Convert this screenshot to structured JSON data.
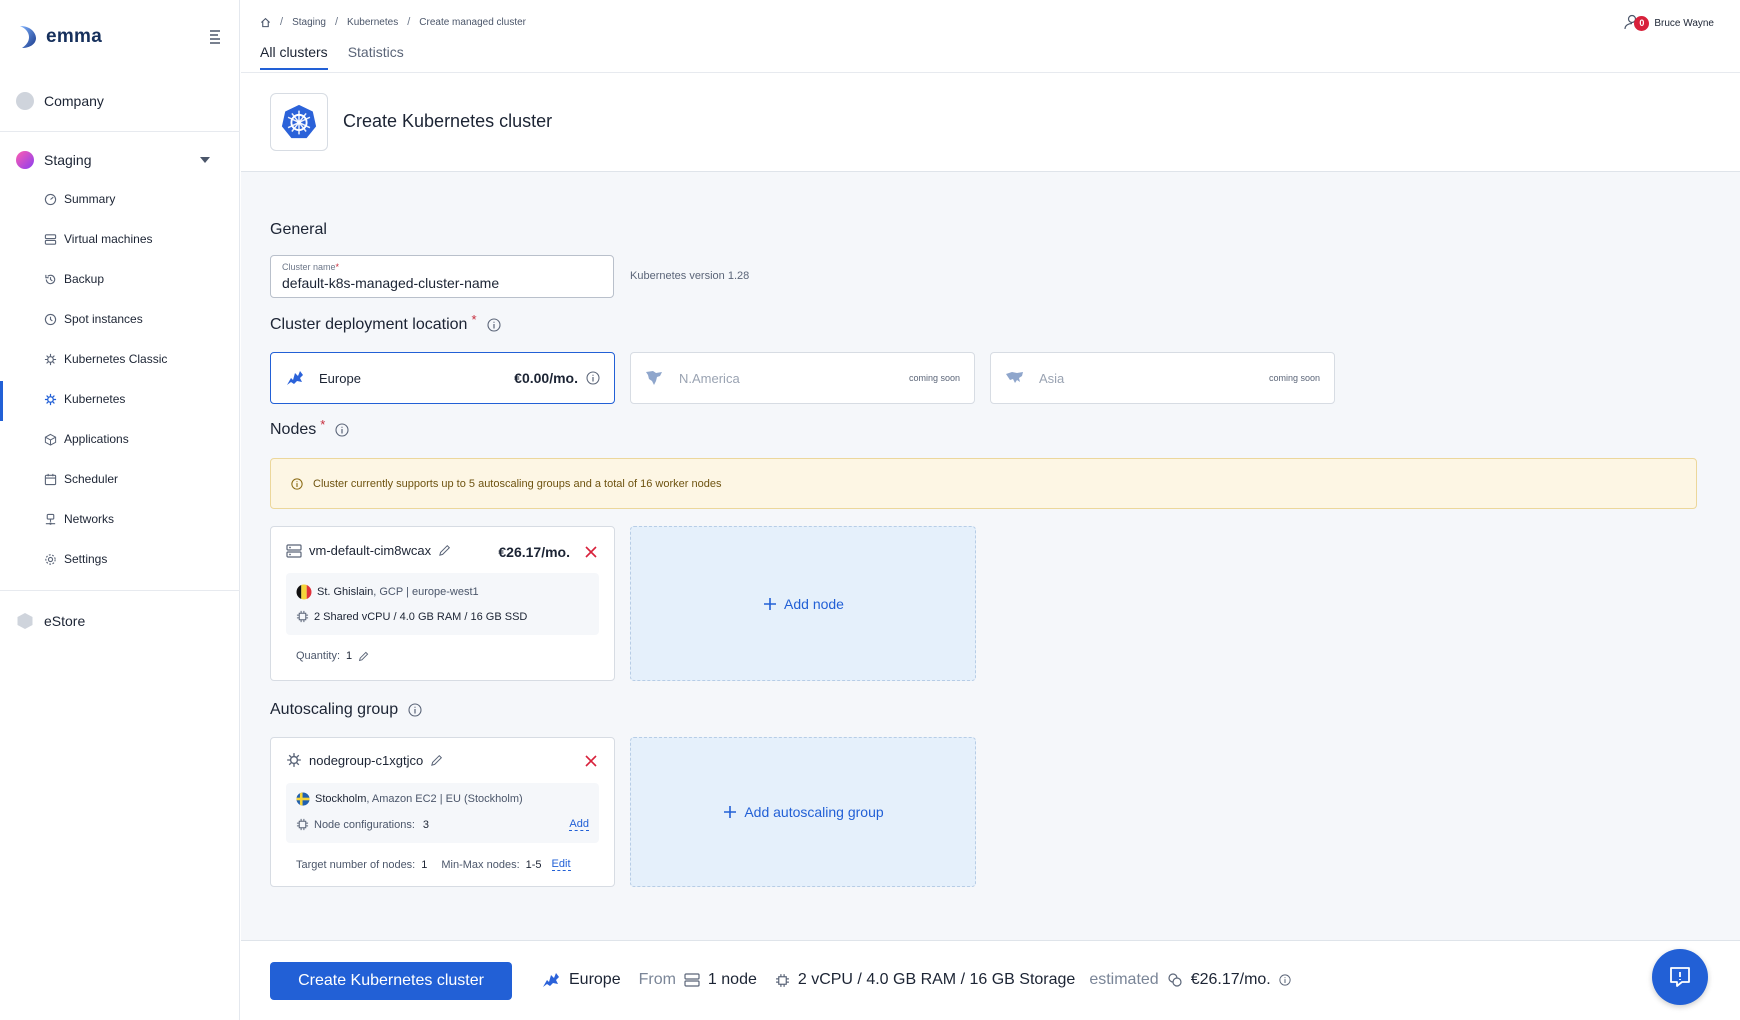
{
  "app": {
    "name": "emma"
  },
  "sidebar": {
    "company": {
      "label": "Company"
    },
    "staging": {
      "label": "Staging"
    },
    "items": [
      {
        "label": "Summary",
        "icon": "dashboard-icon"
      },
      {
        "label": "Virtual machines",
        "icon": "server-icon"
      },
      {
        "label": "Backup",
        "icon": "backup-icon"
      },
      {
        "label": "Spot instances",
        "icon": "clock-icon"
      },
      {
        "label": "Kubernetes Classic",
        "icon": "helm-icon"
      },
      {
        "label": "Kubernetes",
        "icon": "helm-icon"
      },
      {
        "label": "Applications",
        "icon": "box-icon"
      },
      {
        "label": "Scheduler",
        "icon": "calendar-icon"
      },
      {
        "label": "Networks",
        "icon": "network-icon"
      },
      {
        "label": "Settings",
        "icon": "gear-icon"
      }
    ],
    "estore": {
      "label": "eStore"
    }
  },
  "breadcrumb": [
    "Staging",
    "Kubernetes",
    "Create managed cluster"
  ],
  "user": {
    "name": "Bruce Wayne",
    "notifications": "0"
  },
  "tabs": [
    {
      "label": "All clusters",
      "active": true
    },
    {
      "label": "Statistics",
      "active": false
    }
  ],
  "page": {
    "title": "Create Kubernetes cluster"
  },
  "general": {
    "title": "General",
    "cluster_name_label": "Cluster name",
    "cluster_name_value": "default-k8s-managed-cluster-name",
    "k8s_version": "Kubernetes version 1.28"
  },
  "location": {
    "title": "Cluster deployment location",
    "options": [
      {
        "name": "Europe",
        "price": "€0.00/mo."
      },
      {
        "name": "N.America",
        "status": "coming soon"
      },
      {
        "name": "Asia",
        "status": "coming soon"
      }
    ]
  },
  "nodes": {
    "title": "Nodes",
    "notice": "Cluster currently supports up to 5 autoscaling groups and a total of 16 worker nodes",
    "card": {
      "name": "vm-default-cim8wcax",
      "price": "€26.17/mo.",
      "location": "St. Ghislain",
      "provider": ", GCP | europe-west1",
      "spec": "2 Shared vCPU / 4.0 GB RAM / 16 GB SSD",
      "quantity_label": "Quantity:",
      "quantity": "1"
    },
    "add_label": "Add node"
  },
  "autoscaling": {
    "title": "Autoscaling group",
    "card": {
      "name": "nodegroup-c1xgtjco",
      "location": "Stockholm",
      "provider": ", Amazon EC2 | EU (Stockholm)",
      "configs_label": "Node configurations:",
      "configs": "3",
      "add_link": "Add",
      "target_label": "Target number of nodes:",
      "target": "1",
      "minmax_label": "Min-Max nodes:",
      "minmax": "1-5",
      "edit_link": "Edit"
    },
    "add_label": "Add autoscaling group"
  },
  "footer": {
    "create_label": "Create Kubernetes cluster",
    "region": "Europe",
    "from": "From",
    "nodes": "1 node",
    "spec": "2 vCPU / 4.0 GB RAM / 16 GB Storage",
    "estimated": "estimated",
    "price": "€26.17/mo."
  },
  "colors": {
    "primary": "#2260d6",
    "danger": "#d8213b",
    "notice_bg": "#fdf6e4"
  }
}
